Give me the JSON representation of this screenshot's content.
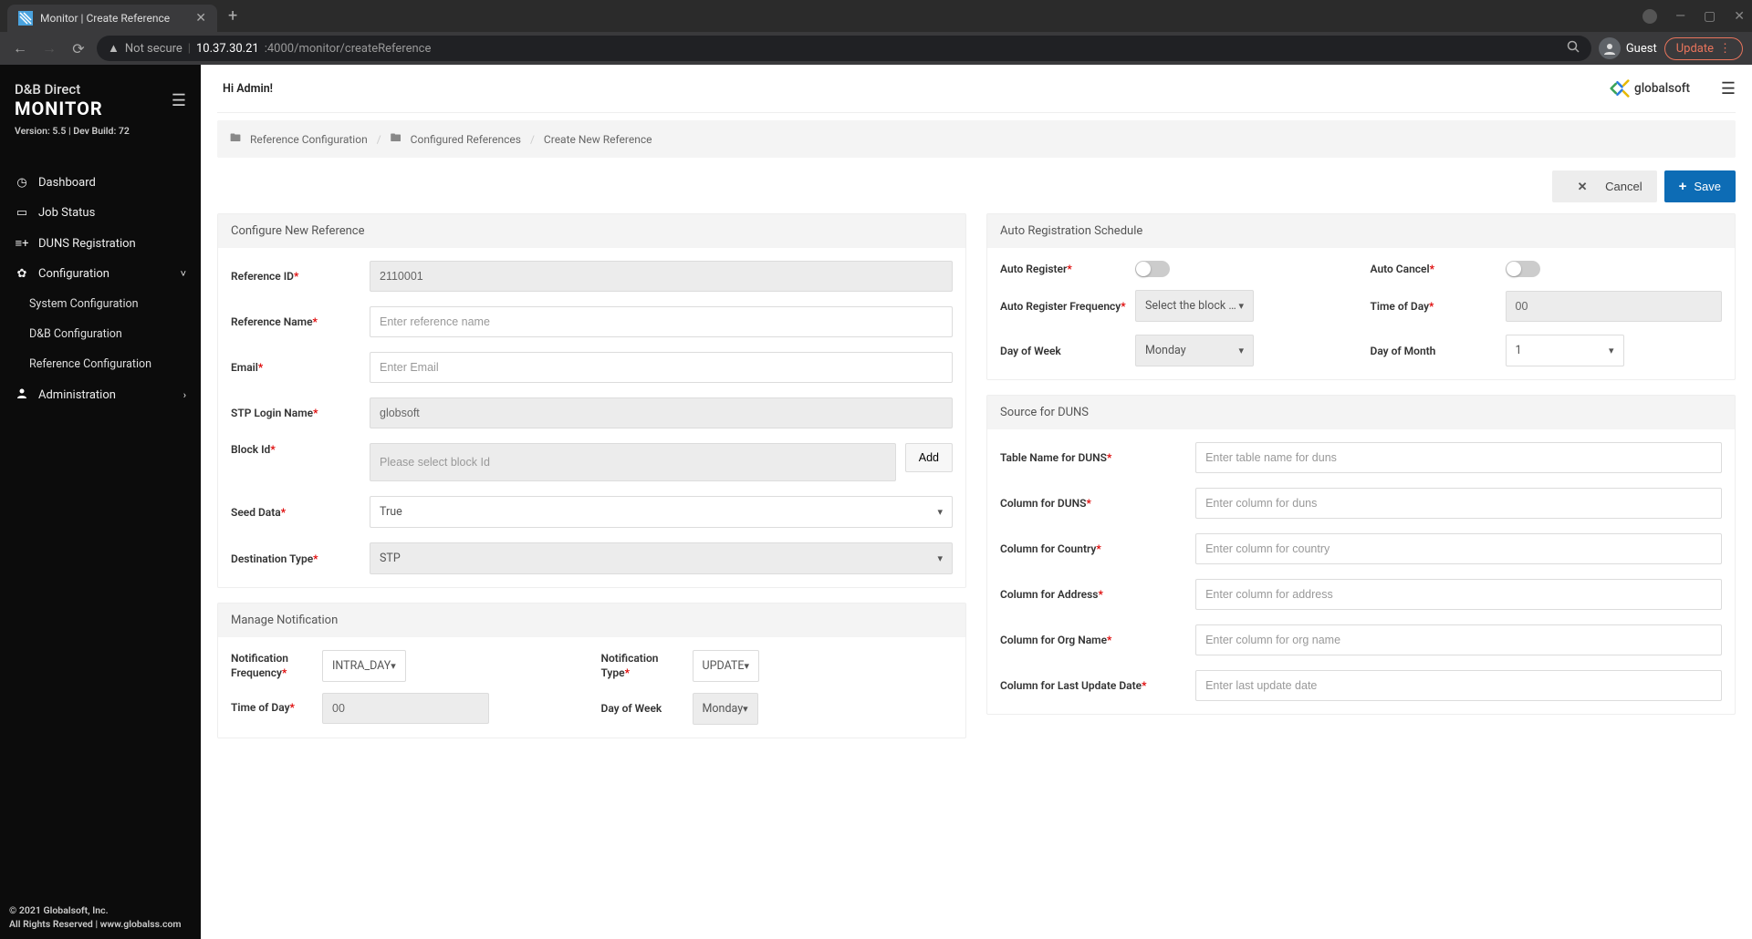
{
  "browser": {
    "tab_title": "Monitor | Create Reference",
    "new_tab": "+",
    "url_not_secure": "Not secure",
    "url_host": "10.37.30.21",
    "url_port_path": ":4000/monitor/createReference",
    "guest_label": "Guest",
    "update_label": "Update"
  },
  "brand": {
    "line1": "D&B Direct",
    "line2": "MONITOR",
    "version": "Version: 5.5 | Dev Build: 72"
  },
  "sidebar": {
    "items": [
      {
        "icon": "gauge",
        "label": "Dashboard"
      },
      {
        "icon": "card",
        "label": "Job Status"
      },
      {
        "icon": "list-plus",
        "label": "DUNS Registration"
      },
      {
        "icon": "gear",
        "label": "Configuration",
        "open": true,
        "chev": "˅",
        "children": [
          {
            "label": "System Configuration"
          },
          {
            "label": "D&B Configuration"
          },
          {
            "label": "Reference Configuration"
          }
        ]
      },
      {
        "icon": "user",
        "label": "Administration",
        "chev": "›"
      }
    ]
  },
  "footer": {
    "line1": "© 2021 Globalsoft, Inc.",
    "line2": "All Rights Reserved | www.globalss.com"
  },
  "header": {
    "greeting": "Hi Admin!",
    "logo_text": "globalsoft"
  },
  "breadcrumbs": [
    "Reference Configuration",
    "Configured References",
    "Create New Reference"
  ],
  "actions": {
    "cancel": "Cancel",
    "save": "Save"
  },
  "configure": {
    "title": "Configure New Reference",
    "reference_id_label": "Reference ID",
    "reference_id_value": "2110001",
    "reference_name_label": "Reference Name",
    "reference_name_placeholder": "Enter reference name",
    "email_label": "Email",
    "email_placeholder": "Enter Email",
    "stp_login_label": "STP Login Name",
    "stp_login_value": "globsoft",
    "block_id_label": "Block Id",
    "block_id_placeholder": "Please select block Id",
    "block_add": "Add",
    "seed_data_label": "Seed Data",
    "seed_data_value": "True",
    "dest_type_label": "Destination Type",
    "dest_type_value": "STP"
  },
  "notification": {
    "title": "Manage Notification",
    "freq_label": "Notification Frequency",
    "freq_value": "INTRA_DAY",
    "type_label": "Notification Type",
    "type_value": "UPDATE",
    "tod_label": "Time of Day",
    "tod_value": "00",
    "dow_label": "Day of Week",
    "dow_value": "Monday"
  },
  "schedule": {
    "title": "Auto Registration Schedule",
    "auto_register_label": "Auto Register",
    "auto_cancel_label": "Auto Cancel",
    "freq_label": "Auto Register Frequency",
    "freq_value": "Select the block aut..",
    "tod_label": "Time of Day",
    "tod_value": "00",
    "dow_label": "Day of Week",
    "dow_value": "Monday",
    "dom_label": "Day of Month",
    "dom_value": "1"
  },
  "source": {
    "title": "Source for DUNS",
    "fields": [
      {
        "label": "Table Name for DUNS",
        "placeholder": "Enter table name for duns"
      },
      {
        "label": "Column for DUNS",
        "placeholder": "Enter column for duns"
      },
      {
        "label": "Column for Country",
        "placeholder": "Enter column for country"
      },
      {
        "label": "Column for Address",
        "placeholder": "Enter column for address"
      },
      {
        "label": "Column for Org Name",
        "placeholder": "Enter column for org name"
      },
      {
        "label": "Column for Last Update Date",
        "placeholder": "Enter last update date"
      }
    ]
  }
}
